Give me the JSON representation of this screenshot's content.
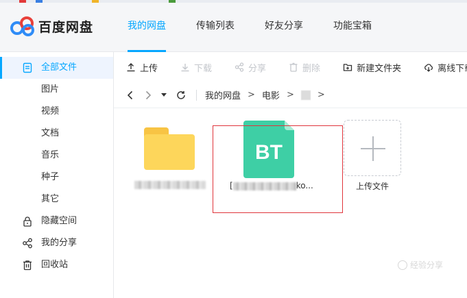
{
  "app": {
    "name": "百度网盘"
  },
  "nav": {
    "items": [
      {
        "label": "我的网盘",
        "active": true
      },
      {
        "label": "传输列表",
        "active": false
      },
      {
        "label": "好友分享",
        "active": false
      },
      {
        "label": "功能宝箱",
        "active": false
      }
    ]
  },
  "sidebar": {
    "items": [
      {
        "label": "全部文件",
        "icon": "document-icon",
        "active": true
      },
      {
        "label": "图片",
        "icon": "",
        "active": false
      },
      {
        "label": "视频",
        "icon": "",
        "active": false
      },
      {
        "label": "文档",
        "icon": "",
        "active": false
      },
      {
        "label": "音乐",
        "icon": "",
        "active": false
      },
      {
        "label": "种子",
        "icon": "",
        "active": false
      },
      {
        "label": "其它",
        "icon": "",
        "active": false
      },
      {
        "label": "隐藏空间",
        "icon": "lock-icon",
        "active": false
      },
      {
        "label": "我的分享",
        "icon": "share-icon",
        "active": false
      },
      {
        "label": "回收站",
        "icon": "trash-icon",
        "active": false
      }
    ]
  },
  "toolbar": {
    "upload": "上传",
    "download": "下载",
    "share": "分享",
    "delete": "删除",
    "new_folder": "新建文件夹",
    "offline_download": "离线下载"
  },
  "breadcrumb": {
    "root": "我的网盘",
    "sep": ">",
    "items": [
      "电影"
    ]
  },
  "files": {
    "bt_icon_text": "BT",
    "bt_name_prefix": "[",
    "bt_name_suffix": "ko...",
    "upload_label": "上传文件"
  },
  "watermark": "经验分享",
  "colors": {
    "accent": "#06a7ff",
    "folder": "#fdd65b",
    "bt": "#3ecfa5",
    "highlight_box": "#e0343b"
  }
}
